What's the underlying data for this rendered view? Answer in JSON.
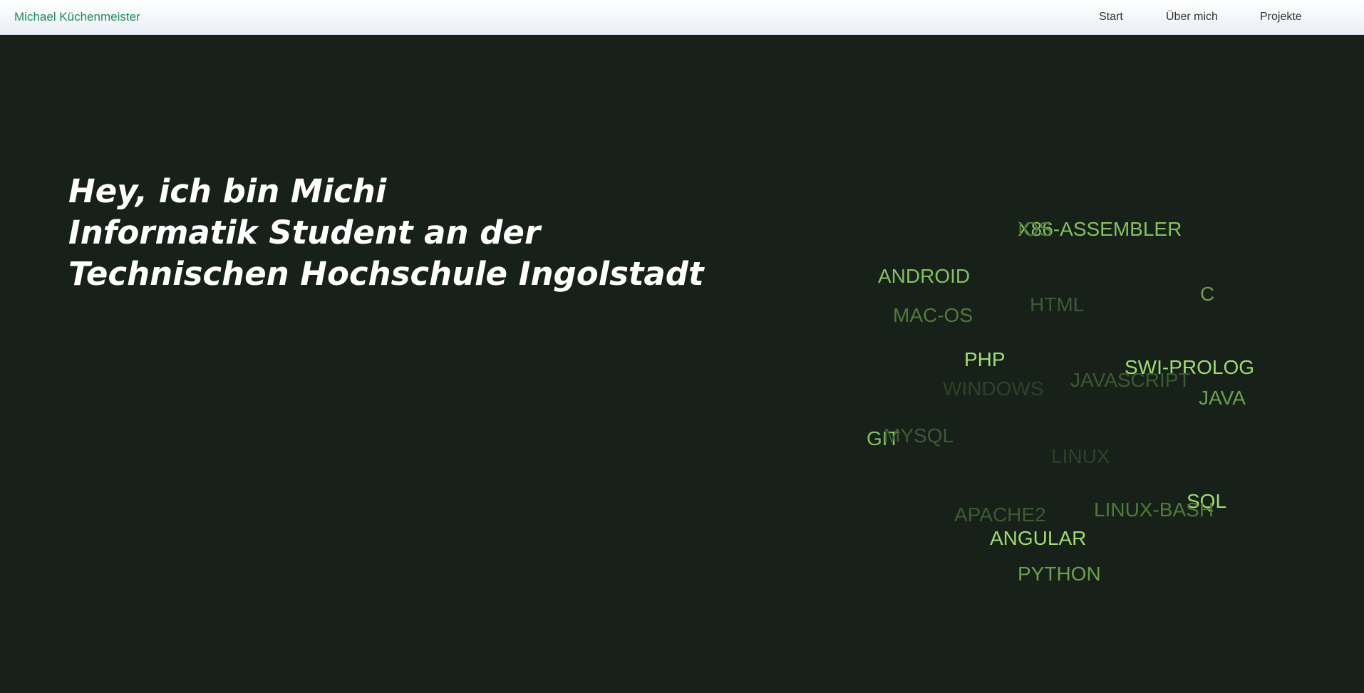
{
  "nav": {
    "brand": "Michael Küchenmeister",
    "links": [
      "Start",
      "Über mich",
      "Projekte"
    ]
  },
  "hero": {
    "line1": "Hey, ich bin Michi",
    "line2": "Informatik Student an der",
    "line3": "Technischen Hochschule Ingolstadt"
  },
  "skills_cloud": [
    {
      "label": "X86-ASSEMBLER",
      "color": "#86c064"
    },
    {
      "label": "IOS",
      "color": "#4f7a3a"
    },
    {
      "label": "ANDROID",
      "color": "#86c064"
    },
    {
      "label": "HTML",
      "color": "#3c5a34"
    },
    {
      "label": "C",
      "color": "#6aa04e"
    },
    {
      "label": "MAC-OS",
      "color": "#507a3c"
    },
    {
      "label": "PHP",
      "color": "#a0dc72"
    },
    {
      "label": "SWI-PROLOG",
      "color": "#a0dc72"
    },
    {
      "label": "JAVASCRIPT",
      "color": "#3c5a34"
    },
    {
      "label": "WINDOWS",
      "color": "#2e4228"
    },
    {
      "label": "JAVA",
      "color": "#6aa04e"
    },
    {
      "label": "GIT",
      "color": "#86c064"
    },
    {
      "label": "MYSQL",
      "color": "#3c5a34"
    },
    {
      "label": "LINUX",
      "color": "#2e4228"
    },
    {
      "label": "SQL",
      "color": "#a0dc72"
    },
    {
      "label": "LINUX-BASH",
      "color": "#4f7a3a"
    },
    {
      "label": "APACHE2",
      "color": "#3c5a34"
    },
    {
      "label": "ANGULAR",
      "color": "#a0dc72"
    },
    {
      "label": "PYTHON",
      "color": "#6aa04e"
    }
  ]
}
